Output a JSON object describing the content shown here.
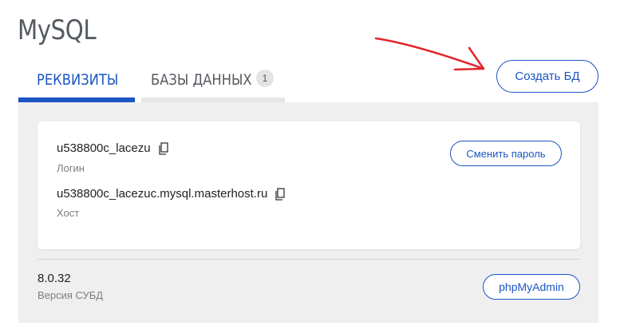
{
  "page": {
    "title": "MySQL"
  },
  "tabs": [
    {
      "label": "РЕКВИЗИТЫ",
      "active": true
    },
    {
      "label": "БАЗЫ ДАННЫХ",
      "count": "1",
      "active": false
    }
  ],
  "actions": {
    "create_db_label": "Создать БД"
  },
  "annotation": {
    "arrow_color": "#e0262d"
  },
  "credentials": {
    "login_value": "u538800c_lacezu",
    "login_label": "Логин",
    "host_value": "u538800c_lacezuc.mysql.masterhost.ru",
    "host_label": "Хост",
    "change_password_label": "Сменить пароль"
  },
  "dbms": {
    "version_value": "8.0.32",
    "version_label": "Версия СУБД",
    "phpmyadmin_label": "phpMyAdmin"
  },
  "colors": {
    "accent": "#1b56c4",
    "panel_bg": "#efefef",
    "muted_text": "#7d7d7d"
  },
  "icons": {
    "copy": "copy-icon"
  }
}
